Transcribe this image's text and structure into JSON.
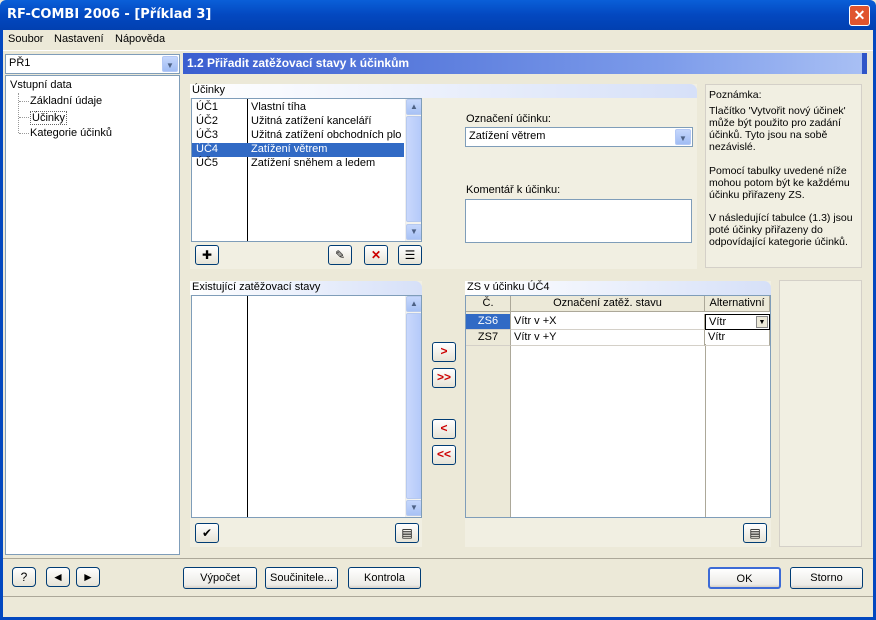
{
  "window": {
    "title": "RF-COMBI 2006 - [Příklad 3]",
    "close_glyph": "✕"
  },
  "menu": [
    "Soubor",
    "Nastavení",
    "Nápověda"
  ],
  "case_selector": {
    "value": "PŘ1"
  },
  "tree": {
    "root": "Vstupní data",
    "children": [
      "Základní údaje",
      "Účinky",
      "Kategorie účinků"
    ],
    "selected_index": 1
  },
  "section": {
    "title": "1.2 Přiřadit zatěžovací stavy k účinkům"
  },
  "ucinky": {
    "header": "Účinky",
    "rows": [
      {
        "id": "ÚČ1",
        "name": "Vlastní tíha"
      },
      {
        "id": "ÚČ2",
        "name": "Užitná zatížení kanceláří"
      },
      {
        "id": "ÚČ3",
        "name": "Užitná zatížení obchodních plo"
      },
      {
        "id": "ÚČ4",
        "name": "Zatížení větrem"
      },
      {
        "id": "ÚČ5",
        "name": "Zatížení sněhem a ledem"
      }
    ],
    "selected_index": 3
  },
  "designation": {
    "label": "Označení účinku:",
    "value": "Zatížení větrem"
  },
  "comment": {
    "label": "Komentář k účinku:"
  },
  "note": {
    "title": "Poznámka:",
    "p1": "Tlačítko 'Vytvořit nový účinek' může být použito pro zadání účinků. Tyto jsou na sobě nezávislé.",
    "p2": "Pomocí tabulky uvedené níže mohou potom být ke každému účinku přiřazeny ZS.",
    "p3": "V následující tabulce (1.3) jsou poté účinky přiřazeny do odpovídající kategorie účinků."
  },
  "existing": {
    "header": "Existující zatěžovací stavy"
  },
  "transfer": {
    "add": ">",
    "add_all": ">>",
    "remove": "<",
    "remove_all": "<<"
  },
  "zs_table": {
    "header": "ZS v účinku ÚČ4",
    "columns": [
      "Č.",
      "Označení zatěž. stavu",
      "Alternativní"
    ],
    "rows": [
      {
        "no": "ZS6",
        "name": "Vítr v +X",
        "alt": "Vítr"
      },
      {
        "no": "ZS7",
        "name": "Vítr v +Y",
        "alt": "Vítr"
      }
    ],
    "selected_index": 0
  },
  "buttons": {
    "calc": "Výpočet",
    "coef": "Součinitele...",
    "check": "Kontrola",
    "ok": "OK",
    "cancel": "Storno"
  },
  "icons": {
    "help": "?",
    "prev": "◄",
    "next": "►"
  }
}
